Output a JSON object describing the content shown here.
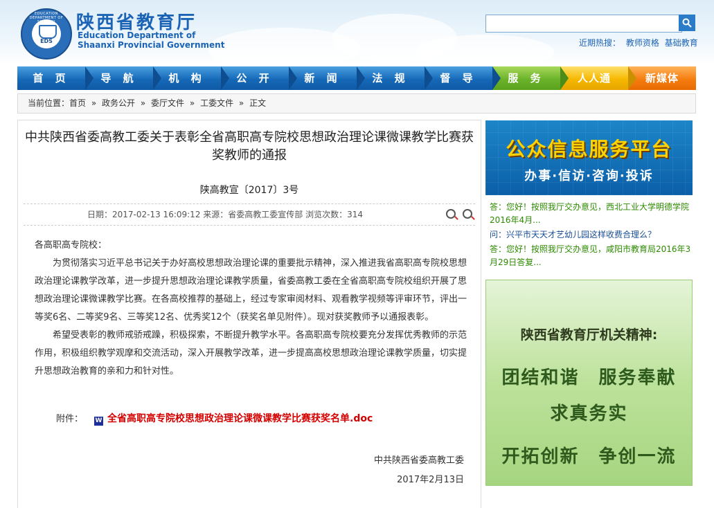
{
  "header": {
    "site_name_cn": "陕西省教育厅",
    "site_name_en_line1": "Education Department of",
    "site_name_en_line2": "Shaanxi Provincial Government",
    "logo_text": "EDS",
    "logo_ring_text": "EDUCATION DEPARTMENT OF SHAANXI",
    "search": {
      "placeholder": "",
      "value": "",
      "button_icon": "search-icon"
    },
    "hot_label": "近期热搜：",
    "hot_links": [
      "教师资格",
      "基础教育"
    ]
  },
  "nav": {
    "items": [
      "首 页",
      "导 航",
      "机 构",
      "公 开",
      "新 闻",
      "法 规",
      "督 导",
      "服 务",
      "人人通",
      "新媒体"
    ],
    "colors": {
      "blue": "#1669b8",
      "green": "#6bb32a",
      "yellow": "#f5b800",
      "orange": "#f57d10"
    }
  },
  "breadcrumb": {
    "label": "当前位置：",
    "items": [
      "首页",
      "政务公开",
      "委厅文件",
      "工委文件",
      "正文"
    ],
    "separator": "»"
  },
  "article": {
    "title": "中共陕西省委高教工委关于表彰全省高职高专院校思想政治理论课微课教学比赛获奖教师的通报",
    "doc_number": "陕高教宣〔2017〕3号",
    "meta": "日期：2017-02-13 16:09:12  来源：省委高教工委宣传部   浏览次数：314",
    "salutation": "各高职高专院校：",
    "paragraphs": [
      "为贯彻落实习近平总书记关于办好高校思想政治理论课的重要批示精神，深入推进我省高职高专院校思想政治理论课教学改革，进一步提升思想政治理论课教学质量，省委高教工委在全省高职高专院校组织开展了思想政治理论课微课教学比赛。在各高校推荐的基础上，经过专家审阅材料、观看教学视频等评审环节，评出一等奖6名、二等奖9名、三等奖12名、优秀奖12个（获奖名单见附件）。现对获奖教师予以通报表彰。",
      "希望受表彰的教师戒骄戒躁，积极探索，不断提升教学水平。各高职高专院校要充分发挥优秀教师的示范作用，积极组织教学观摩和交流活动，深入开展教学改革，进一步提高高校思想政治理论课教学质量，切实提升思想政治教育的亲和力和针对性。"
    ],
    "attachment_label": "附件：",
    "attachment_icon_text": "W",
    "attachment_name": "全省高职高专院校思想政治理论课微课教学比赛获奖名单.doc",
    "signer": "中共陕西省委高教工委",
    "date": "2017年2月13日"
  },
  "sidebar": {
    "banner1_title": "公众信息服务平台",
    "banner1_subtitle": "办事·信访·咨询·投诉",
    "qa": [
      {
        "type": "a",
        "text": "答：您好！按照我厅交办意见，西北工业大学明德学院2016年4月..."
      },
      {
        "type": "q",
        "text": "问：兴平市天天才艺幼儿园这样收费合理么？"
      },
      {
        "type": "a",
        "text": "答：您好！按照我厅交办意见，咸阳市教育局2016年3月29日答复..."
      }
    ],
    "banner2_heading": "陕西省教育厅机关精神:",
    "banner2_lines": [
      "团结和谐　服务奉献",
      "求真务实",
      "开拓创新　争创一流"
    ]
  }
}
